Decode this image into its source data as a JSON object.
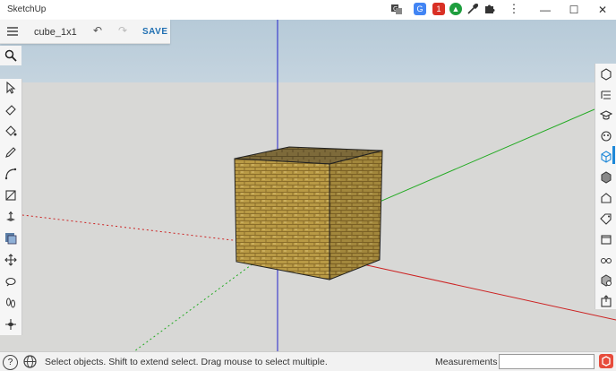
{
  "window": {
    "app_title": "SketchUp",
    "controls": [
      "—",
      "☐",
      "✕"
    ]
  },
  "browser_extensions": [
    {
      "name": "translate-icon",
      "color": "#444444"
    },
    {
      "name": "google-translate-icon",
      "color": "#4285f4"
    },
    {
      "name": "calendar-badge-icon",
      "color": "#d93025"
    },
    {
      "name": "green-circle-icon",
      "color": "#1e9e3e"
    },
    {
      "name": "eyedropper-icon",
      "color": "#333333"
    },
    {
      "name": "puzzle-icon",
      "color": "#333333"
    },
    {
      "name": "kebab-menu-icon",
      "color": "#333333"
    }
  ],
  "toolbar": {
    "document_name": "cube_1x1",
    "undo_glyph": "↶",
    "redo_glyph": "↷",
    "save_label": "SAVE"
  },
  "left_tools": [
    "select-icon",
    "eraser-icon",
    "paint-bucket-icon",
    "pencil-icon",
    "arc-icon",
    "rectangle-icon",
    "push-pull-icon",
    "offset-icon",
    "move-icon",
    "orbit-icon",
    "footprints-icon",
    "walk-icon"
  ],
  "right_tools": [
    "entity-info-icon",
    "outliner-icon",
    "instructor-icon",
    "materials-icon",
    "components-icon",
    "styles-icon",
    "scenes-icon",
    "tags-icon",
    "display-icon",
    "glasses-icon",
    "solid-inspector-icon",
    "export-icon"
  ],
  "status": {
    "help_glyph": "?",
    "message": "Select objects. Shift to extend select. Drag mouse to select multiple.",
    "measurements_label": "Measurements",
    "measurements_value": ""
  },
  "colors": {
    "save_accent": "#1f6fb2",
    "active_panel": "#1e88d8",
    "sky": "#bccdd9",
    "ground": "#d8d8d6",
    "axis_red": "#cc2222",
    "axis_green": "#22aa22",
    "axis_blue": "#2222cc"
  }
}
